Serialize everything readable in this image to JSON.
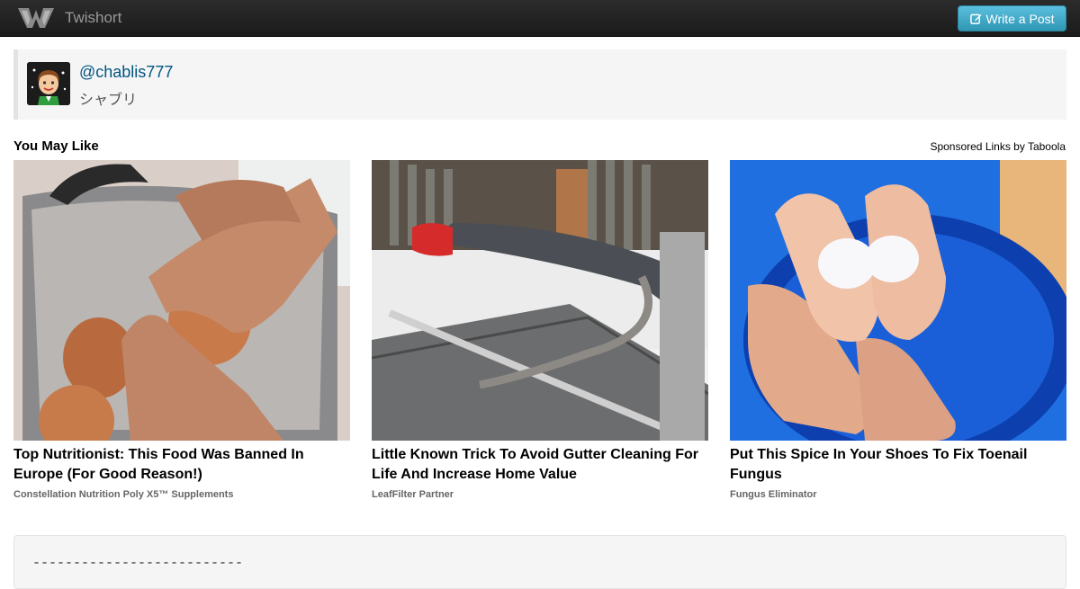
{
  "navbar": {
    "brand": "Twishort",
    "write_button": "Write a Post",
    "accent": "#5bc0de"
  },
  "profile": {
    "handle": "@chablis777",
    "display_name": "シャブリ"
  },
  "recommendations": {
    "heading": "You May Like",
    "sponsored": "Sponsored Links by Taboola",
    "items": [
      {
        "title": "Top Nutritionist: This Food Was Banned In Europe (For Good Reason!)",
        "source": "Constellation Nutrition Poly X5™ Supplements",
        "image": "egg-peeling-photo"
      },
      {
        "title": "Little Known Trick To Avoid Gutter Cleaning For Life And Increase Home Value",
        "source": "LeafFilter Partner",
        "image": "gutter-ladder-photo"
      },
      {
        "title": "Put This Spice In Your Shoes To Fix Toenail Fungus",
        "source": "Fungus Eliminator",
        "image": "feet-in-basin-photo"
      }
    ]
  },
  "post": {
    "text": "--------------------------"
  }
}
